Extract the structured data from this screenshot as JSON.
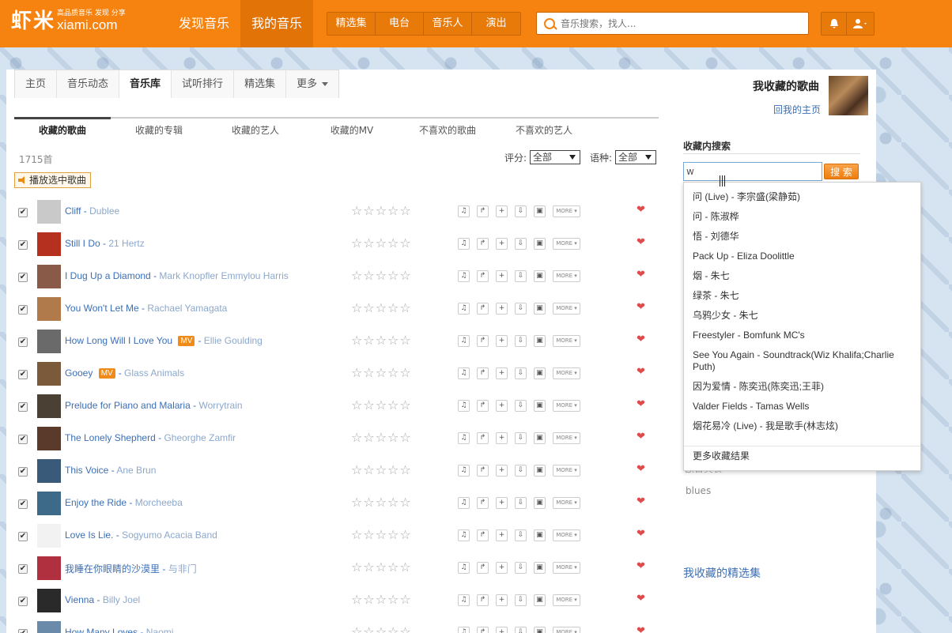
{
  "header": {
    "logo_cn": "虾米",
    "logo_slogan": "高品质音乐 发现 分享",
    "logo_domain": "xiami.com",
    "nav": [
      {
        "label": "发现音乐",
        "active": false
      },
      {
        "label": "我的音乐",
        "active": true
      }
    ],
    "subnav": [
      "精选集",
      "电台",
      "音乐人",
      "演出"
    ],
    "search_placeholder": "音乐搜索，找人...",
    "bell_icon": "bell-icon",
    "user_icon": "user-icon"
  },
  "tabs": [
    {
      "label": "主页",
      "active": false
    },
    {
      "label": "音乐动态",
      "active": false
    },
    {
      "label": "音乐库",
      "active": true
    },
    {
      "label": "试听排行",
      "active": false
    },
    {
      "label": "精选集",
      "active": false
    },
    {
      "label": "更多",
      "active": false
    }
  ],
  "page": {
    "heading": "我收藏的歌曲",
    "back_link": "回我的主页"
  },
  "subtabs": [
    {
      "label": "收藏的歌曲",
      "active": true
    },
    {
      "label": "收藏的专辑",
      "active": false
    },
    {
      "label": "收藏的艺人",
      "active": false
    },
    {
      "label": "收藏的MV",
      "active": false
    },
    {
      "label": "不喜欢的歌曲",
      "active": false
    },
    {
      "label": "不喜欢的艺人",
      "active": false
    }
  ],
  "list": {
    "count": "1715首",
    "rating_label": "评分:",
    "rating_value": "全部",
    "language_label": "语种:",
    "language_value": "全部",
    "play_selected": "播放选中歌曲",
    "more_label": "MORE"
  },
  "songs": [
    {
      "title": "Cliff",
      "artist": "Dublee",
      "mv": false,
      "cover": "#c9c9c9"
    },
    {
      "title": "Still I Do",
      "artist": "21 Hertz",
      "mv": false,
      "cover": "#b5301e"
    },
    {
      "title": "I Dug Up a Diamond",
      "artist": "Mark Knopfler Emmylou Harris",
      "mv": false,
      "cover": "#8a5a48"
    },
    {
      "title": "You Won't Let Me",
      "artist": "Rachael Yamagata",
      "mv": false,
      "cover": "#b07a4a"
    },
    {
      "title": "How Long Will I Love You",
      "artist": "Ellie Goulding",
      "mv": true,
      "cover": "#6a6a6a"
    },
    {
      "title": "Gooey",
      "artist": "Glass Animals",
      "mv": true,
      "cover": "#7a5a3a"
    },
    {
      "title": "Prelude for Piano and Malaria",
      "artist": "Worrytrain",
      "mv": false,
      "cover": "#4a4034"
    },
    {
      "title": "The Lonely Shepherd",
      "artist": "Gheorghe Zamfir",
      "mv": false,
      "cover": "#5a3a2a"
    },
    {
      "title": "This Voice",
      "artist": "Ane Brun",
      "mv": false,
      "cover": "#3a5a7a"
    },
    {
      "title": "Enjoy the Ride",
      "artist": "Morcheeba",
      "mv": false,
      "cover": "#3e6a8a"
    },
    {
      "title": "Love Is Lie.",
      "artist": "Sogyumo Acacia Band",
      "mv": false,
      "cover": "#f2f2f2"
    },
    {
      "title": "我睡在你眼睛的沙漠里",
      "artist": "与非门",
      "mv": false,
      "cover": "#b03040"
    },
    {
      "title": "Vienna",
      "artist": "Billy Joel",
      "mv": false,
      "cover": "#2a2a2a"
    },
    {
      "title": "How Many Loves",
      "artist": "Naomi",
      "mv": false,
      "cover": "#6a8aaa"
    }
  ],
  "sidebar": {
    "search_title": "收藏内搜索",
    "search_value": "w",
    "search_button": "搜 索",
    "results": [
      "问 (Live) - 李宗盛(梁静茹)",
      "问 - 陈淑桦",
      "悟 - 刘德华",
      "Pack Up - Eliza Doolittle",
      "烟 - 朱七",
      "绿茶 - 朱七",
      "乌鸦少女 - 朱七",
      "Freestyler - Bomfunk MC's",
      "See You Again - Soundtrack(Wiz Khalifa;Charlie Puth)",
      "因为爱情 - 陈奕迅(陈奕迅;王菲)",
      "Valder Fields - Tamas Wells",
      "烟花易冷 (Live) - 我是歌手(林志炫)"
    ],
    "more_results": "更多收藏结果",
    "tag_partial": "欧日美食",
    "tag_blues": "blues",
    "my_collections": "我收藏的精选集"
  }
}
